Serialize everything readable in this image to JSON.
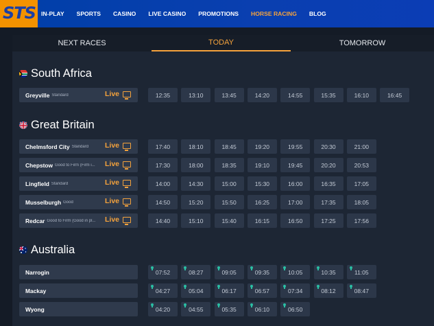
{
  "header": {
    "logo": "STS",
    "nav": [
      "IN-PLAY",
      "SPORTS",
      "CASINO",
      "LIVE CASINO",
      "PROMOTIONS",
      "HORSE RACING",
      "BLOG"
    ],
    "active_nav": "HORSE RACING"
  },
  "tabs": [
    {
      "label": "NEXT RACES",
      "active": false
    },
    {
      "label": "TODAY",
      "active": true
    },
    {
      "label": "TOMORROW",
      "active": false
    }
  ],
  "countries": [
    {
      "name": "South Africa",
      "flag": "za-flag-icon",
      "tracks": [
        {
          "name": "Greyville",
          "condition": "Standard",
          "live": "Live",
          "times": [
            "12:35",
            "13:10",
            "13:45",
            "14:20",
            "14:55",
            "15:35",
            "16:10",
            "16:45"
          ]
        }
      ]
    },
    {
      "name": "Great Britain",
      "flag": "gb-flag-icon",
      "tracks": [
        {
          "name": "Chelmsford City",
          "condition": "Standard",
          "live": "Live",
          "times": [
            "17:40",
            "18:10",
            "18:45",
            "19:20",
            "19:55",
            "20:30",
            "21:00"
          ]
        },
        {
          "name": "Chepstow",
          "condition": "Good to Firm (Firm i...",
          "live": "Live",
          "times": [
            "17:30",
            "18:00",
            "18:35",
            "19:10",
            "19:45",
            "20:20",
            "20:53"
          ]
        },
        {
          "name": "Lingfield",
          "condition": "Standard",
          "live": "Live",
          "times": [
            "14:00",
            "14:30",
            "15:00",
            "15:30",
            "16:00",
            "16:35",
            "17:05"
          ]
        },
        {
          "name": "Musselburgh",
          "condition": "Good",
          "live": "Live",
          "times": [
            "14:50",
            "15:20",
            "15:50",
            "16:25",
            "17:00",
            "17:35",
            "18:05"
          ]
        },
        {
          "name": "Redcar",
          "condition": "Good to Firm (Good in pl...",
          "live": "Live",
          "times": [
            "14:40",
            "15:10",
            "15:40",
            "16:15",
            "16:50",
            "17:25",
            "17:56"
          ]
        }
      ]
    },
    {
      "name": "Australia",
      "flag": "au-flag-icon",
      "tracks": [
        {
          "name": "Narrogin",
          "condition": "",
          "live": "",
          "times": [
            "07:52",
            "08:27",
            "09:05",
            "09:35",
            "10:05",
            "10:35",
            "11:05"
          ]
        },
        {
          "name": "Mackay",
          "condition": "",
          "live": "",
          "times": [
            "04:27",
            "05:04",
            "06:17",
            "06:57",
            "07:34",
            "08:12",
            "08:47"
          ]
        },
        {
          "name": "Wyong",
          "condition": "",
          "live": "",
          "times": [
            "04:20",
            "04:55",
            "05:35",
            "06:10",
            "06:50"
          ]
        }
      ]
    }
  ],
  "colors": {
    "accent": "#f6a33c",
    "pin": "#2bbfa4",
    "nav_bg": "#0a3fb0",
    "logo_bg": "#f39200"
  }
}
